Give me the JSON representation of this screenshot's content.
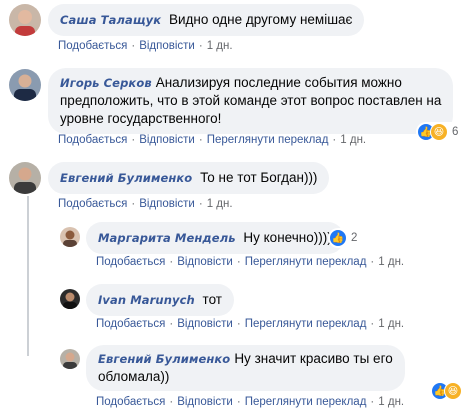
{
  "actions": {
    "like": "Подобається",
    "reply": "Відповісти",
    "translate": "Переглянути переклад",
    "time": "1 дн.",
    "sep": "·"
  },
  "comments": [
    {
      "author": "Саша Талащук",
      "text": "Видно одне другому немішає",
      "show_translate": false
    },
    {
      "author": "Игорь Серков",
      "text_line1": "Анализируя последние события можно",
      "text_line2": "предположить, что в этой команде этот вопрос поставлен на",
      "text_line3": "уровне государственного!",
      "reactions_count": "6",
      "show_translate": true
    },
    {
      "author": "Евгений Булименко",
      "text": "То не тот Богдан)))",
      "show_translate": false
    },
    {
      "author": "Маргарита Мендель",
      "text": "Ну конечно))))",
      "reactions_count": "2",
      "show_translate": true
    },
    {
      "author": "Ivan Marunych",
      "text": "тот",
      "show_translate": true
    },
    {
      "author": "Евгений Булименко",
      "text_line1": "Ну значит красиво ты его",
      "text_line2": "обломала))",
      "show_translate": true
    }
  ],
  "colors": {
    "author": "#385898",
    "bubble": "#f0f2f5",
    "meta": "#65676b",
    "like_reaction": "#2078f4",
    "haha_reaction": "#f7b125"
  }
}
